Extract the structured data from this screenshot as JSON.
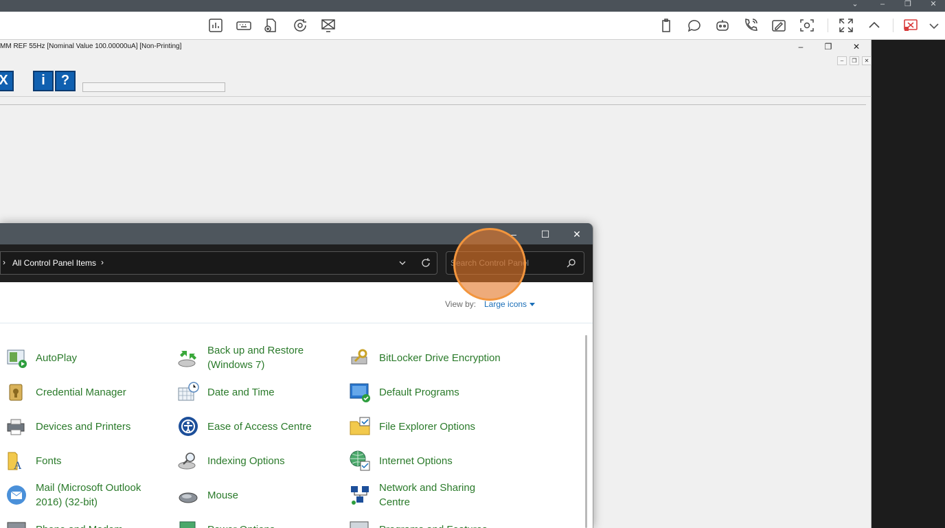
{
  "app": {
    "title": "MM REF 55Hz [Nominal Value 100.00000uA] [Non-Printing]",
    "buttons": [
      {
        "label": "X",
        "name": "exit-button"
      },
      {
        "label": "i",
        "name": "info-button"
      },
      {
        "label": "?",
        "name": "help-button"
      }
    ]
  },
  "control_panel": {
    "breadcrumb": {
      "current": "All Control Panel Items"
    },
    "search": {
      "placeholder": "Search Control Panel"
    },
    "view_by": {
      "label": "View by:",
      "value": "Large icons"
    },
    "items": [
      {
        "label": "AutoPlay",
        "icon": "autoplay-icon"
      },
      {
        "label": "Back up and Restore (Windows 7)",
        "icon": "backup-restore-icon"
      },
      {
        "label": "BitLocker Drive Encryption",
        "icon": "bitlocker-icon"
      },
      {
        "label": "Credential Manager",
        "icon": "credential-manager-icon"
      },
      {
        "label": "Date and Time",
        "icon": "date-time-icon"
      },
      {
        "label": "Default Programs",
        "icon": "default-programs-icon"
      },
      {
        "label": "Devices and Printers",
        "icon": "devices-printers-icon"
      },
      {
        "label": "Ease of Access Centre",
        "icon": "ease-of-access-icon"
      },
      {
        "label": "File Explorer Options",
        "icon": "file-explorer-options-icon"
      },
      {
        "label": "Fonts",
        "icon": "fonts-icon"
      },
      {
        "label": "Indexing Options",
        "icon": "indexing-options-icon"
      },
      {
        "label": "Internet Options",
        "icon": "internet-options-icon"
      },
      {
        "label": "Mail (Microsoft Outlook 2016) (32-bit)",
        "icon": "mail-icon"
      },
      {
        "label": "Mouse",
        "icon": "mouse-icon"
      },
      {
        "label": "Network and Sharing Centre",
        "icon": "network-sharing-icon"
      },
      {
        "label": "Phone and Modem",
        "icon": "phone-modem-icon"
      },
      {
        "label": "Power Options",
        "icon": "power-options-icon"
      },
      {
        "label": "Programs and Features",
        "icon": "programs-features-icon"
      }
    ]
  },
  "colors": {
    "link_green": "#2a7a2a",
    "accent_blue": "#1b6fb8",
    "title_bar": "#4e565d",
    "click_highlight": "#f2953d"
  }
}
